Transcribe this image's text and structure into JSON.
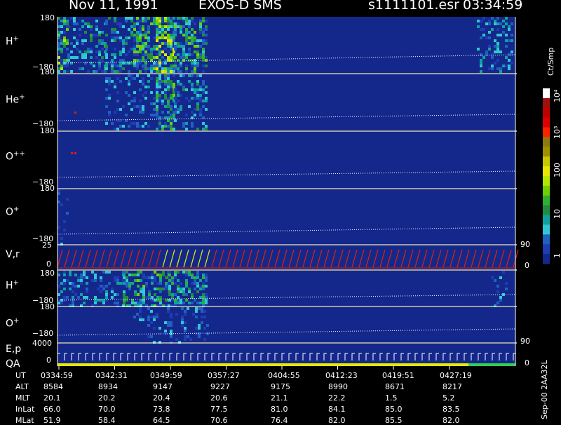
{
  "header": {
    "date": "Nov 11, 1991",
    "instrument": "EXOS-D SMS",
    "file": "s1111101.esr",
    "time": "03:34:59"
  },
  "panels": [
    {
      "label": "H",
      "sup": "+",
      "ytop": "180",
      "ybot": "−180"
    },
    {
      "label": "He",
      "sup": "+",
      "ytop": "180",
      "ybot": "−180"
    },
    {
      "label": "O",
      "sup": "++",
      "ytop": "180",
      "ybot": "−180"
    },
    {
      "label": "O",
      "sup": "+",
      "ytop": "180",
      "ybot": "−180"
    },
    {
      "label": "V,r",
      "sup": "",
      "ytop": "25",
      "ybot": "0",
      "rtop": "90",
      "rbot": "0"
    },
    {
      "label": "H",
      "sup": "+",
      "ytop": "180",
      "ybot": "−180"
    },
    {
      "label": "O",
      "sup": "+",
      "ytop": "180",
      "ybot": "−180"
    },
    {
      "label": "E,p",
      "label2": "QA",
      "sup": "",
      "ytop": "4000",
      "ybot": "0",
      "rtop": "90",
      "rbot": "0"
    }
  ],
  "colorbar": {
    "title": "Ct/Smp",
    "labels": [
      "10⁴",
      "10³",
      "100",
      "10",
      "1"
    ],
    "colors": [
      "#ffffff",
      "#a01010",
      "#c00000",
      "#e00000",
      "#ff2000",
      "#8c7a10",
      "#a09000",
      "#c8c800",
      "#e6e600",
      "#b4e600",
      "#70d000",
      "#30b030",
      "#208c40",
      "#10a0a0",
      "#30c8d0",
      "#2060c0",
      "#1e3cb4",
      "#14288c"
    ]
  },
  "chart_data": {
    "type": "heatmap",
    "title": "Nov 11, 1991   EXOS-D SMS",
    "x_axis_label": "UT",
    "x_ticks": [
      "0334:59",
      "0342:31",
      "0349:59",
      "0357:27",
      "0404:55",
      "0412:23",
      "0419:51",
      "0427:19"
    ],
    "colorbar_unit": "Ct/Smp",
    "colorbar_scale": "log",
    "colorbar_range": [
      1,
      10000
    ],
    "panels": [
      "H+",
      "He+",
      "O++",
      "O+",
      "V,r",
      "H+",
      "O+",
      "E,p / QA"
    ],
    "ephemeris": [
      {
        "name": "UT",
        "values": [
          "0334:59",
          "0342:31",
          "0349:59",
          "0357:27",
          "0404:55",
          "0412:23",
          "0419:51",
          "0427:19"
        ]
      },
      {
        "name": "ALT",
        "values": [
          "8584",
          "8934",
          "9147",
          "9227",
          "9175",
          "8990",
          "8671",
          "8217"
        ]
      },
      {
        "name": "MLT",
        "values": [
          "20.1",
          "20.2",
          "20.4",
          "20.6",
          "21.1",
          "22.2",
          "1.5",
          "5.2"
        ]
      },
      {
        "name": "InLat",
        "values": [
          "66.0",
          "70.0",
          "73.8",
          "77.5",
          "81.0",
          "84.1",
          "85.0",
          "83.5"
        ]
      },
      {
        "name": "MLat",
        "values": [
          "51.9",
          "58.4",
          "64.5",
          "70.6",
          "76.4",
          "82.0",
          "85.5",
          "82.0"
        ]
      }
    ]
  },
  "footer": {
    "id": "Sep-00 2AA32L"
  }
}
